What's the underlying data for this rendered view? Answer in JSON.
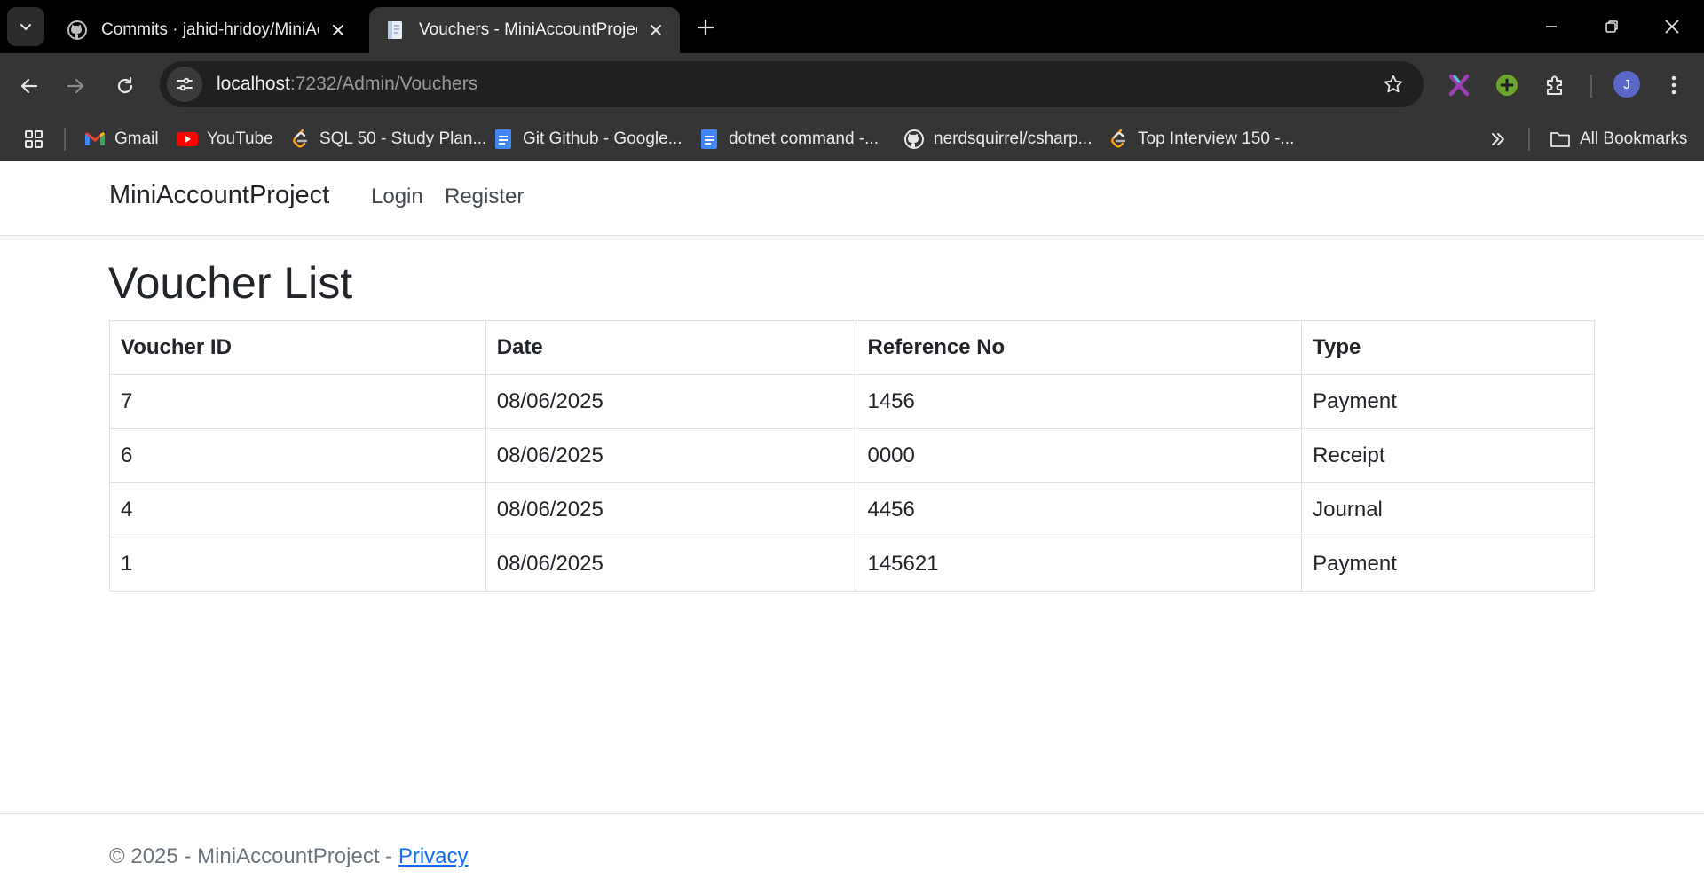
{
  "browser": {
    "tabs": [
      {
        "title": "Commits · jahid-hridoy/MiniAcc",
        "icon": "github-icon",
        "active": false
      },
      {
        "title": "Vouchers - MiniAccountProject",
        "icon": "document-icon",
        "active": true
      }
    ],
    "url": {
      "host": "localhost",
      "path": ":7232/Admin/Vouchers"
    },
    "profile_initial": "J",
    "bookmarks": [
      {
        "label": "Gmail",
        "icon": "gmail-icon"
      },
      {
        "label": "YouTube",
        "icon": "youtube-icon"
      },
      {
        "label": "SQL 50 - Study Plan...",
        "icon": "leetcode-icon"
      },
      {
        "label": "Git Github - Google...",
        "icon": "google-docs-icon"
      },
      {
        "label": "dotnet command -...",
        "icon": "google-docs-icon"
      },
      {
        "label": "nerdsquirrel/csharp...",
        "icon": "github-icon"
      },
      {
        "label": "Top Interview 150 -...",
        "icon": "leetcode-icon"
      }
    ],
    "all_bookmarks": "All Bookmarks",
    "colors": {
      "chrome_dark": "#000000",
      "toolbar": "#353535",
      "omnibox": "#202020",
      "avatar": "#5b67c9"
    }
  },
  "app": {
    "brand": "MiniAccountProject",
    "nav": {
      "login": "Login",
      "register": "Register"
    },
    "heading": "Voucher List",
    "table": {
      "columns": [
        "Voucher ID",
        "Date",
        "Reference No",
        "Type"
      ],
      "rows": [
        [
          "7",
          "08/06/2025",
          "1456",
          "Payment"
        ],
        [
          "6",
          "08/06/2025",
          "0000",
          "Receipt"
        ],
        [
          "4",
          "08/06/2025",
          "4456",
          "Journal"
        ],
        [
          "1",
          "08/06/2025",
          "145621",
          "Payment"
        ]
      ]
    },
    "footer": {
      "text": "© 2025 - MiniAccountProject - ",
      "link": "Privacy"
    },
    "colors": {
      "link": "#0d6efd",
      "text": "#212529",
      "muted": "#6c757d",
      "border": "#dee2e6"
    }
  }
}
